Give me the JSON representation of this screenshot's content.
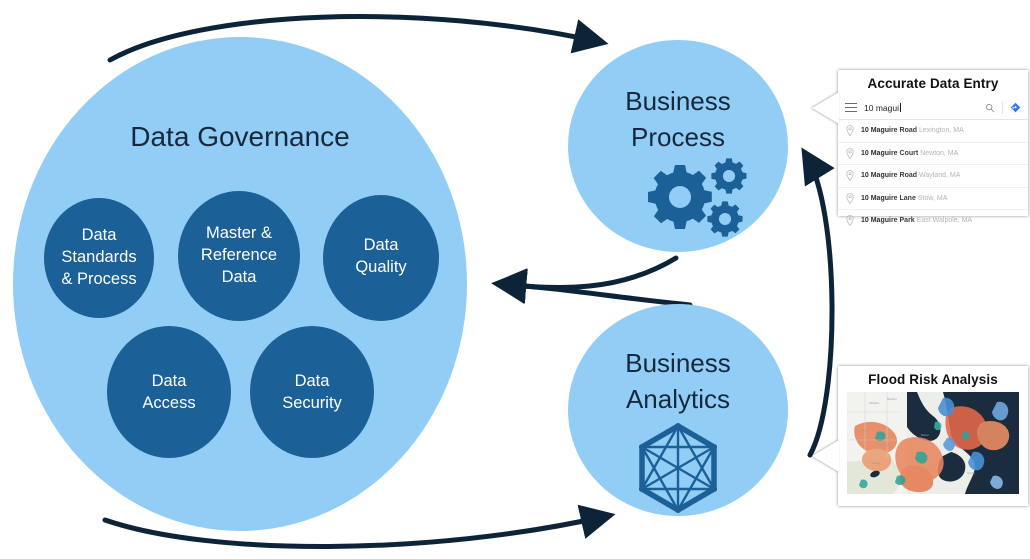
{
  "diagram": {
    "type": "venn-cycle-diagram",
    "governance": {
      "title": "Data Governance",
      "bubbles": [
        {
          "id": "data-standards-process",
          "lines": [
            "Data",
            "Standards",
            "& Process"
          ]
        },
        {
          "id": "master-reference-data",
          "lines": [
            "Master &",
            "Reference",
            "Data"
          ]
        },
        {
          "id": "data-quality",
          "lines": [
            "Data",
            "Quality"
          ]
        },
        {
          "id": "data-access",
          "lines": [
            "Data",
            "Access"
          ]
        },
        {
          "id": "data-security",
          "lines": [
            "Data",
            "Security"
          ]
        }
      ]
    },
    "nodes": [
      {
        "id": "business-process",
        "lines": [
          "Business",
          "Process"
        ],
        "icon": "gears-icon"
      },
      {
        "id": "business-analytics",
        "lines": [
          "Business",
          "Analytics"
        ],
        "icon": "network-hexagon-icon"
      }
    ],
    "colors": {
      "pale_blue": "#92cdf6",
      "deep_blue": "#1b6096",
      "navy_text": "#16293c",
      "arrow": "#0d2438",
      "card_bg": "#ffffff"
    }
  },
  "callouts": {
    "accurate_data_entry": {
      "title": "Accurate Data Entry",
      "search": {
        "value": "10 magui",
        "menu_icon": "hamburger-icon",
        "search_icon": "search-icon",
        "directions_icon": "directions-icon"
      },
      "suggestions": [
        {
          "bold": "10 Magui",
          "main": "re Road",
          "sub": "Lexington, MA"
        },
        {
          "bold": "10 Magui",
          "main": "re Court",
          "sub": "Newton, MA"
        },
        {
          "bold": "10 Magui",
          "main": "re Road",
          "sub": "Wayland, MA"
        },
        {
          "bold": "10 Magui",
          "main": "re Lane",
          "sub": "Stow, MA"
        },
        {
          "bold": "10 Magui",
          "main": "re Park",
          "sub": "East Walpole, MA"
        }
      ]
    },
    "flood_risk_analysis": {
      "title": "Flood Risk Analysis",
      "image_description": "choropleth flood risk heat map of Boston harbor area"
    }
  }
}
